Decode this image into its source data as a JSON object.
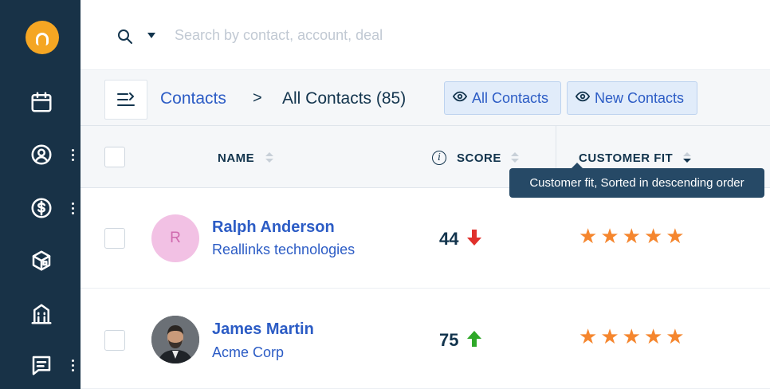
{
  "sidebar": {
    "items": [
      {
        "name": "calendar"
      },
      {
        "name": "contacts"
      },
      {
        "name": "deals"
      },
      {
        "name": "products"
      },
      {
        "name": "accounts"
      },
      {
        "name": "conversations"
      }
    ]
  },
  "search": {
    "placeholder": "Search by contact, account, deal"
  },
  "breadcrumb": {
    "parent": "Contacts",
    "separator": ">",
    "current": "All Contacts (85)"
  },
  "views": {
    "all_label": "All Contacts",
    "new_label": "New Contacts"
  },
  "table": {
    "columns": {
      "name": "NAME",
      "score": "SCORE",
      "customer_fit": "CUSTOMER FIT"
    },
    "tooltip": "Customer fit, Sorted in descending order",
    "rows": [
      {
        "initial": "R",
        "name": "Ralph Anderson",
        "account": "Reallinks technologies",
        "score": "44",
        "trend": "down",
        "stars": 5
      },
      {
        "initial": "",
        "name": "James Martin",
        "account": "Acme Corp",
        "score": "75",
        "trend": "up",
        "stars": 5
      }
    ]
  },
  "colors": {
    "sidebar": "#183247",
    "brand": "#f5a623",
    "link": "#2c5cc5",
    "star": "#f5862e",
    "trend_down": "#e0302b",
    "trend_up": "#2ea828"
  }
}
